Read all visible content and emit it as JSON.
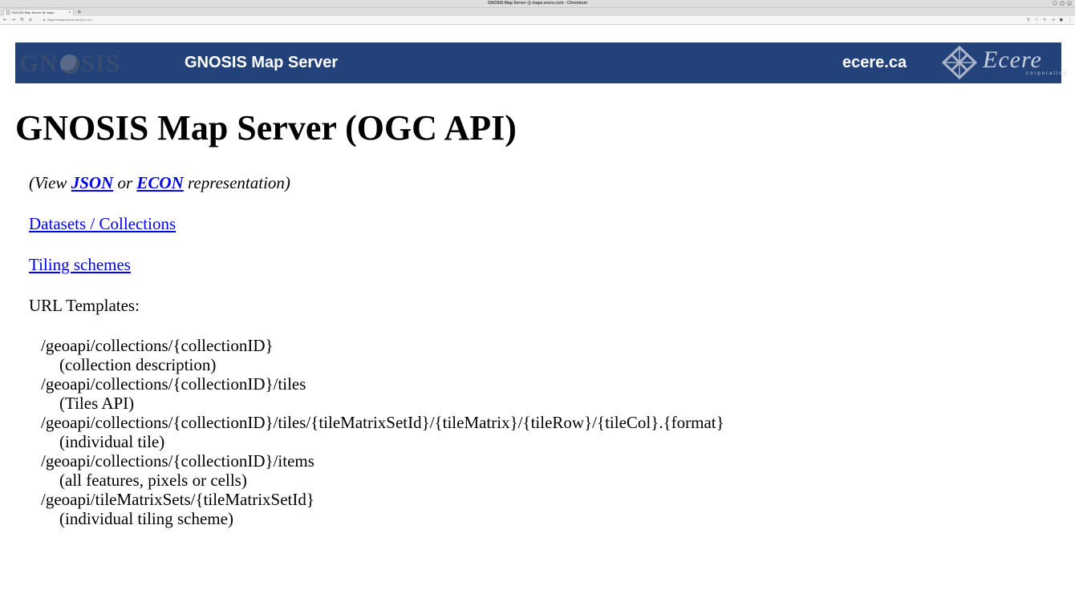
{
  "browser": {
    "window_title": "GNOSIS Map Server @ maps.ecere.com - Chromium",
    "tab_title": "GNOSIS Map Server @ maps",
    "url_host": "https://maps.ecere.com/",
    "url_path": "geoapi/"
  },
  "banner": {
    "logo_left_pre": "GN",
    "logo_left_post": "SIS",
    "title": "GNOSIS Map Server",
    "domain": "ecere.ca",
    "logo_right_name": "Ecere",
    "logo_right_sub": "corporation",
    "background_color": "#24427a"
  },
  "page": {
    "title": "GNOSIS Map Server (OGC API)",
    "view_prefix": "(View ",
    "json_link": "JSON",
    "view_or": " or ",
    "econ_link": "ECON",
    "view_suffix": " representation)",
    "datasets_link": "Datasets / Collections",
    "tiling_link": "Tiling schemes",
    "templates_label": "URL Templates:",
    "templates": [
      {
        "path": "/geoapi/collections/{collectionID}",
        "desc": "(collection description)"
      },
      {
        "path": "/geoapi/collections/{collectionID}/tiles",
        "desc": "(Tiles API)"
      },
      {
        "path": "/geoapi/collections/{collectionID}/tiles/{tileMatrixSetId}/{tileMatrix}/{tileRow}/{tileCol}.{format}",
        "desc": "(individual tile)"
      },
      {
        "path": "/geoapi/collections/{collectionID}/items",
        "desc": "(all features, pixels or cells)"
      },
      {
        "path": "/geoapi/tileMatrixSets/{tileMatrixSetId}",
        "desc": "(individual tiling scheme)"
      }
    ],
    "link_color": "#0000ee"
  }
}
